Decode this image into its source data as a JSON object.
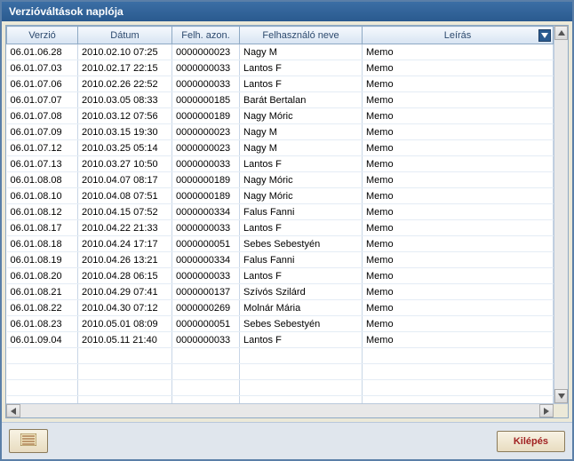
{
  "window": {
    "title": "Verzióváltások naplója"
  },
  "grid": {
    "columns": {
      "version": "Verzió",
      "date": "Dátum",
      "userId": "Felh. azon.",
      "userName": "Felhasználó neve",
      "description": "Leírás"
    },
    "rows": [
      {
        "version": "06.01.06.28",
        "date": "2010.02.10 07:25",
        "userId": "0000000023",
        "userName": "Nagy M",
        "description": "Memo"
      },
      {
        "version": "06.01.07.03",
        "date": "2010.02.17 22:15",
        "userId": "0000000033",
        "userName": "Lantos F",
        "description": "Memo"
      },
      {
        "version": "06.01.07.06",
        "date": "2010.02.26 22:52",
        "userId": "0000000033",
        "userName": "Lantos F",
        "description": "Memo"
      },
      {
        "version": "06.01.07.07",
        "date": "2010.03.05 08:33",
        "userId": "0000000185",
        "userName": "Barát Bertalan",
        "description": "Memo"
      },
      {
        "version": "06.01.07.08",
        "date": "2010.03.12 07:56",
        "userId": "0000000189",
        "userName": "Nagy Móric",
        "description": "Memo"
      },
      {
        "version": "06.01.07.09",
        "date": "2010.03.15 19:30",
        "userId": "0000000023",
        "userName": "Nagy M",
        "description": "Memo"
      },
      {
        "version": "06.01.07.12",
        "date": "2010.03.25 05:14",
        "userId": "0000000023",
        "userName": "Nagy M",
        "description": "Memo"
      },
      {
        "version": "06.01.07.13",
        "date": "2010.03.27 10:50",
        "userId": "0000000033",
        "userName": "Lantos F",
        "description": "Memo"
      },
      {
        "version": "06.01.08.08",
        "date": "2010.04.07 08:17",
        "userId": "0000000189",
        "userName": "Nagy Móric",
        "description": "Memo"
      },
      {
        "version": "06.01.08.10",
        "date": "2010.04.08 07:51",
        "userId": "0000000189",
        "userName": "Nagy Móric",
        "description": "Memo"
      },
      {
        "version": "06.01.08.12",
        "date": "2010.04.15 07:52",
        "userId": "0000000334",
        "userName": "Falus Fanni",
        "description": "Memo"
      },
      {
        "version": "06.01.08.17",
        "date": "2010.04.22 21:33",
        "userId": "0000000033",
        "userName": "Lantos F",
        "description": "Memo"
      },
      {
        "version": "06.01.08.18",
        "date": "2010.04.24 17:17",
        "userId": "0000000051",
        "userName": "Sebes Sebestyén",
        "description": "Memo"
      },
      {
        "version": "06.01.08.19",
        "date": "2010.04.26 13:21",
        "userId": "0000000334",
        "userName": "Falus Fanni",
        "description": "Memo"
      },
      {
        "version": "06.01.08.20",
        "date": "2010.04.28 06:15",
        "userId": "0000000033",
        "userName": "Lantos F",
        "description": "Memo"
      },
      {
        "version": "06.01.08.21",
        "date": "2010.04.29 07:41",
        "userId": "0000000137",
        "userName": "Szívós Szilárd",
        "description": "Memo"
      },
      {
        "version": "06.01.08.22",
        "date": "2010.04.30 07:12",
        "userId": "0000000269",
        "userName": "Molnár Mária",
        "description": "Memo"
      },
      {
        "version": "06.01.08.23",
        "date": "2010.05.01 08:09",
        "userId": "0000000051",
        "userName": "Sebes Sebestyén",
        "description": "Memo"
      },
      {
        "version": "06.01.09.04",
        "date": "2010.05.11 21:40",
        "userId": "0000000033",
        "userName": "Lantos F",
        "description": "Memo"
      }
    ]
  },
  "footer": {
    "exitLabel": "Kilépés"
  }
}
